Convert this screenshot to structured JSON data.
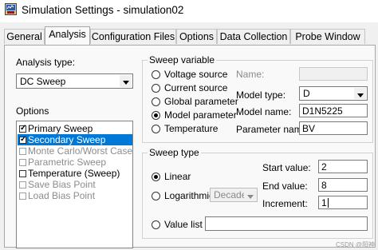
{
  "window": {
    "title": "Simulation Settings - simulation02"
  },
  "tabs": [
    {
      "label": "General"
    },
    {
      "label": "Analysis"
    },
    {
      "label": "Configuration Files"
    },
    {
      "label": "Options"
    },
    {
      "label": "Data Collection"
    },
    {
      "label": "Probe Window"
    }
  ],
  "analysis": {
    "label": "Analysis type:",
    "value": "DC Sweep"
  },
  "options": {
    "label": "Options",
    "items": [
      {
        "label": "Primary Sweep"
      },
      {
        "label": "Secondary Sweep"
      },
      {
        "label": "Monte Carlo/Worst Case"
      },
      {
        "label": "Parametric Sweep"
      },
      {
        "label": "Temperature (Sweep)"
      },
      {
        "label": "Save Bias Point"
      },
      {
        "label": "Load Bias Point"
      }
    ]
  },
  "sweep_variable": {
    "title": "Sweep variable",
    "radios": [
      {
        "label": "Voltage source"
      },
      {
        "label": "Current source"
      },
      {
        "label": "Global parameter"
      },
      {
        "label": "Model parameter"
      },
      {
        "label": "Temperature"
      }
    ],
    "name_label": "Name:",
    "name_value": "",
    "model_type_label": "Model type:",
    "model_type_value": "D",
    "model_name_label": "Model name:",
    "model_name_value": "D1N5225",
    "param_name_label": "Parameter name:",
    "param_name_value": "BV"
  },
  "sweep_type": {
    "title": "Sweep type",
    "linear_label": "Linear",
    "log_label": "Logarithmic",
    "log_option": "Decade",
    "value_list_label": "Value list",
    "value_list_value": "",
    "start_label": "Start value:",
    "start_value": "2",
    "end_label": "End value:",
    "end_value": "8",
    "increment_label": "Increment:",
    "increment_value": "1"
  },
  "watermark": "CSDN @阳神"
}
